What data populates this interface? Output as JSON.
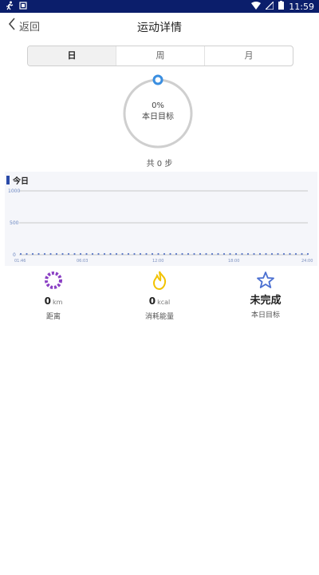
{
  "status_bar": {
    "time": "11:59"
  },
  "header": {
    "back_label": "返回",
    "title": "运动详情"
  },
  "tabs": [
    {
      "label": "日",
      "active": true
    },
    {
      "label": "周",
      "active": false
    },
    {
      "label": "月",
      "active": false
    }
  ],
  "progress": {
    "percent_label": "0%",
    "caption": "本日目标",
    "value": 0
  },
  "total_steps": "共 0 步",
  "chart_data": {
    "type": "line",
    "title": "今日",
    "y_ticks": [
      "1000",
      "500",
      "0"
    ],
    "ylim": [
      0,
      1000
    ],
    "x_ticks": [
      "01:46",
      "06:03",
      "12:00",
      "18:00",
      "24:00"
    ],
    "values": [
      0,
      0,
      0,
      0,
      0,
      0,
      0,
      0,
      0,
      0,
      0,
      0,
      0,
      0,
      0,
      0,
      0,
      0,
      0,
      0,
      0,
      0,
      0,
      0,
      0,
      0,
      0,
      0,
      0,
      0,
      0,
      0,
      0,
      0,
      0,
      0,
      0,
      0,
      0,
      0,
      0,
      0,
      0,
      0,
      0,
      0,
      0,
      0,
      0
    ],
    "grid": true
  },
  "stats": [
    {
      "value": "0",
      "unit": "km",
      "label": "距离",
      "icon": "distance-icon",
      "color": "#8a3fc4"
    },
    {
      "value": "0",
      "unit": "kcal",
      "label": "消耗能量",
      "icon": "flame-icon",
      "color": "#f2c200"
    },
    {
      "value": "未完成",
      "unit": "",
      "label": "本日目标",
      "icon": "star-icon",
      "color": "#4a6fd1"
    }
  ]
}
